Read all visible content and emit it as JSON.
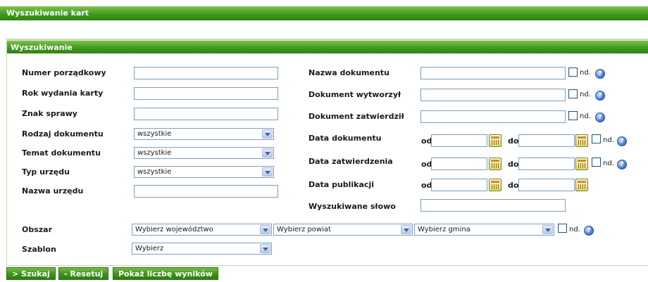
{
  "header": {
    "title": "Wyszukiwanie kart"
  },
  "panel": {
    "title": "Wyszukiwanie"
  },
  "left_fields": [
    {
      "label": "Numer porządkowy",
      "value": ""
    },
    {
      "label": "Rok wydania karty",
      "value": ""
    },
    {
      "label": "Znak sprawy",
      "value": ""
    },
    {
      "label": "Rodzaj dokumentu",
      "value": "wszystkie"
    },
    {
      "label": "Temat dokumentu",
      "value": "wszystkie"
    },
    {
      "label": "Typ urzędu",
      "value": "wszystkie"
    },
    {
      "label": "Nazwa urzędu",
      "value": ""
    }
  ],
  "right_fields": [
    {
      "label": "Nazwa dokumentu",
      "value": ""
    },
    {
      "label": "Dokument wytworzył",
      "value": ""
    },
    {
      "label": "Dokument zatwierdził",
      "value": ""
    },
    {
      "label": "Data dokumentu",
      "from": "",
      "to": ""
    },
    {
      "label": "Data zatwierdzenia",
      "from": "",
      "to": ""
    },
    {
      "label": "Data publikacji",
      "from": "",
      "to": ""
    },
    {
      "label": "Wyszukiwane słowo",
      "value": ""
    }
  ],
  "range": {
    "from_label": "od",
    "to_label": "do"
  },
  "nd_label": "nd.",
  "help_glyph": "?",
  "obszar": {
    "label": "Obszar",
    "wojewodztwo": "Wybierz województwo",
    "powiat": "Wybierz powiat",
    "gmina": "Wybierz gmina"
  },
  "szablon": {
    "label": "Szablon",
    "value": "Wybierz"
  },
  "buttons": {
    "search": "> Szukaj",
    "reset": "- Resetuj",
    "count": "Pokaż liczbę wyników"
  },
  "colors": {
    "header_green": "#3f9b1d",
    "input_border": "#7f9db9"
  }
}
